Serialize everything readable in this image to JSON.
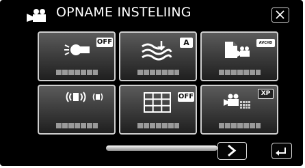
{
  "header": {
    "title": "OPNAME INSTELIING",
    "mode_icon": "video-camera-icon",
    "close_icon": "close-icon"
  },
  "tiles": [
    {
      "icon": "light-bulb-icon",
      "badge": "OFF"
    },
    {
      "icon": "wind-filter-icon",
      "badge": "A"
    },
    {
      "icon": "record-format-icon",
      "badge": "AVCHD"
    },
    {
      "icon": "image-stabilizer-icon",
      "badge": ""
    },
    {
      "icon": "grid-icon",
      "badge": "OFF"
    },
    {
      "icon": "video-quality-icon",
      "badge": "XP"
    }
  ],
  "navigation": {
    "next_icon": "chevron-right-icon",
    "back_icon": "return-arrow-icon"
  }
}
